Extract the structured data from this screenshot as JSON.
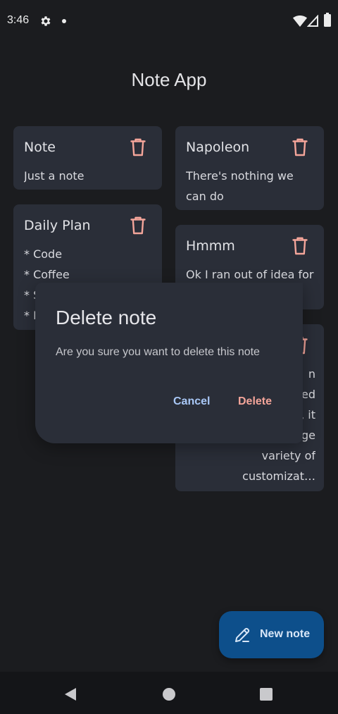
{
  "status_bar": {
    "time": "3:46",
    "icons": [
      "gear-icon",
      "notification-dot-icon",
      "wifi-icon",
      "signal-icon",
      "battery-icon"
    ]
  },
  "app": {
    "title": "Note App"
  },
  "notes": [
    {
      "title": "Note",
      "body": "Just a note"
    },
    {
      "title": "Daily Plan",
      "body": "* Code\n* Coffee\n* S\n* I"
    },
    {
      "title": "Napoleon",
      "body": "There's nothing we\ncan do"
    },
    {
      "title": "Hmmm",
      "body": "Ok I ran out of idea for"
    },
    {
      "title": "",
      "body": "n\ned\n, it\nfeatures a large\nvariety of customizat…"
    }
  ],
  "dialog": {
    "title": "Delete note",
    "message": "Are you sure you want to delete this note",
    "cancel_label": "Cancel",
    "delete_label": "Delete"
  },
  "fab": {
    "label": "New note",
    "icon": "pencil-icon"
  },
  "colors": {
    "background": "#1b1c1f",
    "card": "#2a2e38",
    "delete_accent": "#f4a59a",
    "cancel_accent": "#a9c8f7",
    "fab": "#0d4f8b"
  }
}
